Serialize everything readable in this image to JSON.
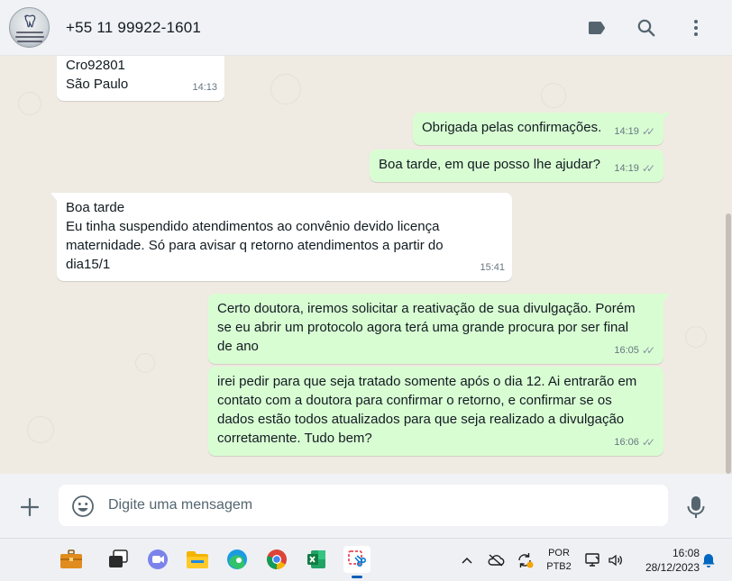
{
  "header": {
    "contact_name": "+55 11 99922-1601"
  },
  "messages": [
    {
      "direction": "in",
      "text": "Cro92801\nSão Paulo",
      "time": "14:13"
    },
    {
      "direction": "out",
      "text": "Obrigada pelas confirmações.",
      "time": "14:19",
      "status": "read"
    },
    {
      "direction": "out",
      "text": "Boa tarde, em que posso lhe ajudar?",
      "time": "14:19",
      "status": "read"
    },
    {
      "direction": "in",
      "text": "Boa tarde\nEu tinha suspendido atendimentos ao convênio devido licença\nmaternidade. Só para avisar q retorno atendimentos a partir do\ndia15/1",
      "time": "15:41"
    },
    {
      "direction": "out",
      "text": "Certo doutora, iremos solicitar a reativação de sua divulgação. Porém\nse eu abrir um protocolo agora terá uma grande procura por ser final\nde ano",
      "time": "16:05",
      "status": "read"
    },
    {
      "direction": "out",
      "text": "irei pedir para que seja tratado somente após o dia 12. Ai entrarão em\ncontato com a doutora para confirmar o retorno, e confirmar se os\ndados estão todos atualizados para que seja realizado a divulgação\ncorretamente. Tudo bem?",
      "time": "16:06",
      "status": "read"
    }
  ],
  "input": {
    "placeholder": "Digite uma mensagem"
  },
  "taskbar": {
    "apps": [
      "briefcase",
      "task-view",
      "teams",
      "file-explorer",
      "edge",
      "chrome",
      "excel",
      "snipping-tool"
    ],
    "language_line1": "POR",
    "language_line2": "PTB2",
    "time": "16:08",
    "date": "28/12/2023"
  },
  "colors": {
    "outgoing_bubble": "#d9fdd3",
    "incoming_bubble": "#ffffff",
    "chat_background": "#efeae2",
    "header_background": "#f0f2f5",
    "read_ticks": "#8696a0"
  }
}
